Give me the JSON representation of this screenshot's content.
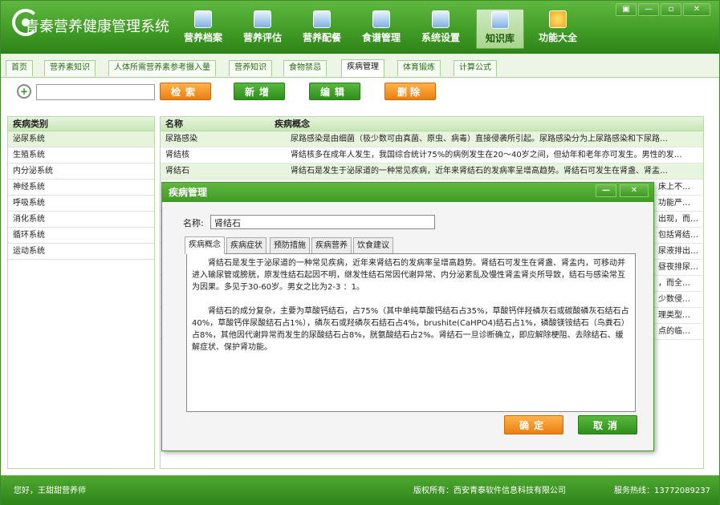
{
  "app": {
    "title": "青秦营养健康管理系统"
  },
  "topnav": [
    {
      "label": "营养档案",
      "icon": "archive-icon"
    },
    {
      "label": "营养评估",
      "icon": "assessment-icon"
    },
    {
      "label": "营养配餐",
      "icon": "meal-icon"
    },
    {
      "label": "食谱管理",
      "icon": "recipe-icon"
    },
    {
      "label": "系统设置",
      "icon": "gear-icon"
    },
    {
      "label": "知识库",
      "icon": "knowledge-icon",
      "active": true
    },
    {
      "label": "功能大全",
      "icon": "star-icon"
    }
  ],
  "window_controls": {
    "skin": "▣",
    "minimize": "—",
    "restore": "▫",
    "close": "✕"
  },
  "subtabs": [
    "首页",
    "营养素知识",
    "人体所需营养素参考摄入量",
    "营养知识",
    "食物禁忌",
    "疾病管理",
    "体育锻炼",
    "计算公式"
  ],
  "toolbar": {
    "search_placeholder": "",
    "search": "检索",
    "add": "新增",
    "edit": "编辑",
    "delete": "删除"
  },
  "left_panel": {
    "header": "疾病类别",
    "items": [
      "泌尿系统",
      "生殖系统",
      "内分泌系统",
      "神经系统",
      "呼吸系统",
      "消化系统",
      "循环系统",
      "运动系统"
    ]
  },
  "table": {
    "headers": [
      "名称",
      "疾病概念"
    ],
    "rows": [
      {
        "name": "尿路感染",
        "desc": "尿路感染是由细菌（极少数可由真菌、原虫、病毒）直接侵袭所引起。尿路感染分为上尿路感染和下尿路…"
      },
      {
        "name": "肾结核",
        "desc": "肾结核多在成年人发生，我国综合统计75%的病例发生在20～40岁之间，但幼年和老年亦可发生。男性的发…"
      },
      {
        "name": "肾结石",
        "desc": "肾结石是发生于泌尿道的一种常见疾病，近年来肾结石的发病率呈增高趋势。肾结石可发生在肾盏、肾盂…"
      },
      {
        "name": "",
        "desc": "床上不…"
      },
      {
        "name": "",
        "desc": "功能严…"
      },
      {
        "name": "",
        "desc": "出现，而…"
      },
      {
        "name": "",
        "desc": "包括肾结…"
      },
      {
        "name": "",
        "desc": "尿液排出…"
      },
      {
        "name": "",
        "desc": "昼夜排尿…"
      },
      {
        "name": "",
        "desc": "，而全…"
      },
      {
        "name": "",
        "desc": "少数侵…"
      },
      {
        "name": "",
        "desc": "理类型…"
      },
      {
        "name": "",
        "desc": "点的临…"
      }
    ]
  },
  "dialog": {
    "title": "疾病管理",
    "name_label": "名称:",
    "name_value": "肾结石",
    "tabs": [
      "疾病概念",
      "疾病症状",
      "预防措施",
      "疾病营养",
      "饮食建议"
    ],
    "paragraphs": [
      "肾结石是发生于泌尿道的一种常见疾病，近年来肾结石的发病率呈增高趋势。肾结石可发生在肾盏、肾盂内，可移动并进入输尿管或膀胱，原发性结石起因不明，继发性结石常因代谢异常、内分泌紊乱及慢性肾盂肾炎所导致，结石与感染常互为因果。多见于30-60岁。男女之比为2-3 ：1。",
      "肾结石的成分复杂，主要为草酸钙结石，占75%（其中单纯草酸钙结石占35%，草酸钙伴羟磷灰石或碳酸磷灰石结石占40%，草酸钙伴尿酸结石占1%），磷灰石或羟磷灰石结石占4%，brushite(CaHPO4)结石占1%，磷酸镁铵结石（鸟粪石）占8%，其他因代谢异常而发生的尿酸结石占8%，胱氨酸结石占2%。肾结石一旦诊断确立，即应解除梗阻、去除结石、缓解症状、保护肾功能。"
    ],
    "ok": "确定",
    "cancel": "取消",
    "minimize": "—",
    "close": "✕"
  },
  "status": {
    "user": "您好，王甜甜营养师",
    "copyright": "版权所有：西安青泰软件信息科技有限公司",
    "hotline": "服务热线：13772089237"
  }
}
